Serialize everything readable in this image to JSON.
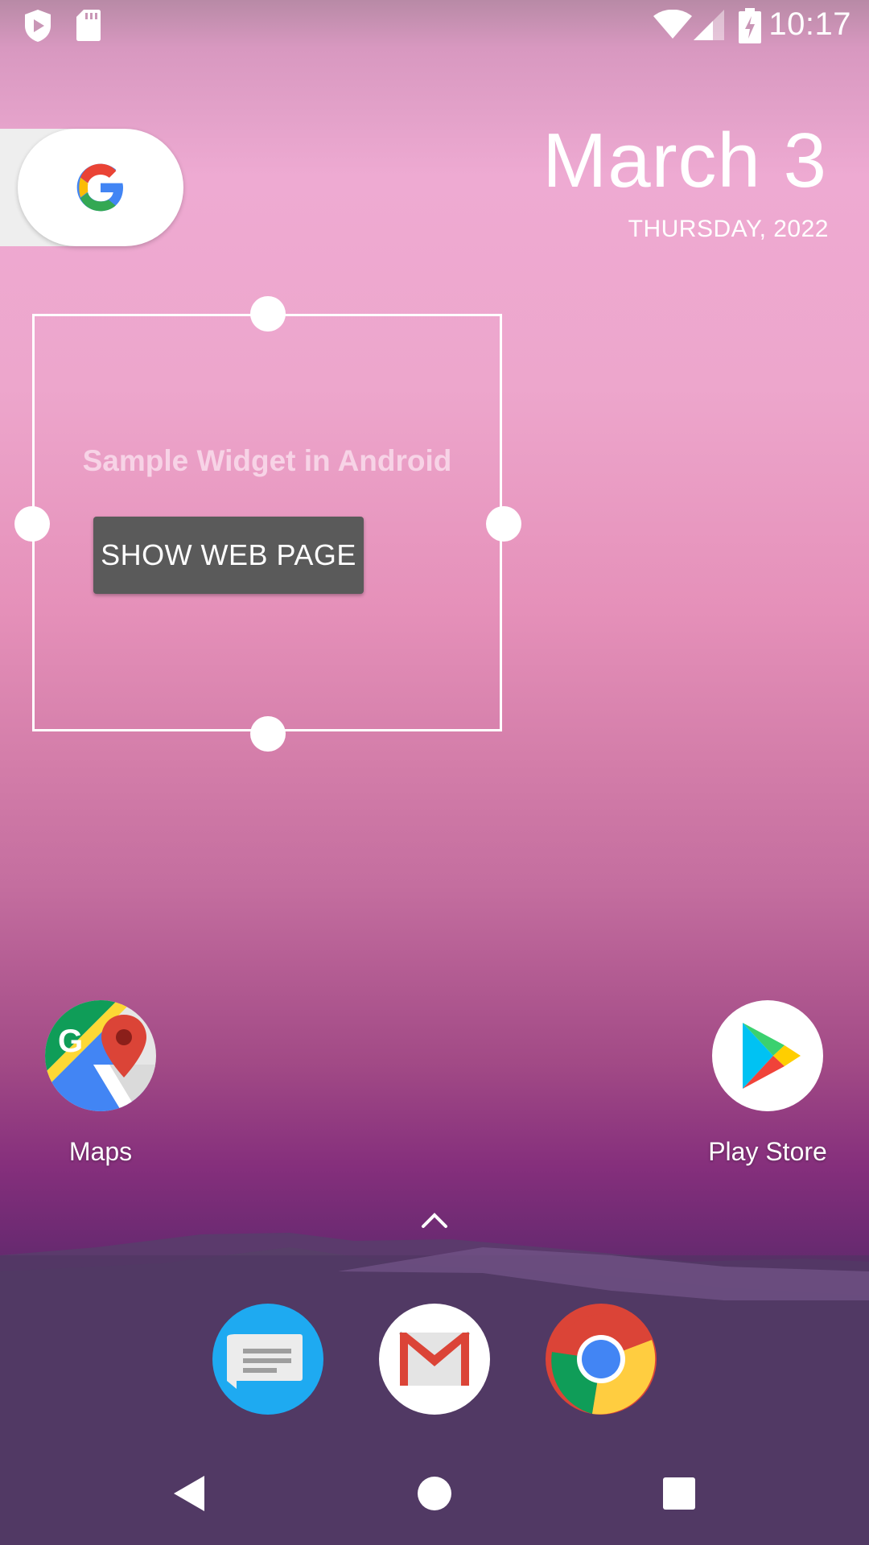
{
  "status_bar": {
    "time": "10:17",
    "left_icons": [
      "shield-play-icon",
      "sd-card-icon"
    ],
    "right_icons": [
      "wifi-icon",
      "cell-signal-icon",
      "battery-charging-icon"
    ]
  },
  "google_search": {
    "icon": "google-g-icon"
  },
  "date_widget": {
    "date": "March 3",
    "weekday_year": "THURSDAY, 2022"
  },
  "sample_widget": {
    "title": "Sample Widget in Android",
    "button_label": "SHOW WEB PAGE"
  },
  "home_apps": [
    {
      "label": "Maps",
      "icon": "google-maps-icon"
    },
    {
      "label": "Play Store",
      "icon": "play-store-icon"
    }
  ],
  "dock_apps": [
    {
      "icon": "messages-icon"
    },
    {
      "icon": "gmail-icon"
    },
    {
      "icon": "chrome-icon"
    }
  ],
  "nav_bar": {
    "buttons": [
      "back-icon",
      "home-icon",
      "recents-icon"
    ]
  },
  "colors": {
    "widget_button_bg": "#5a5a5a",
    "widget_title": "#f7d3e6",
    "dock_bg": "#4c3461"
  }
}
